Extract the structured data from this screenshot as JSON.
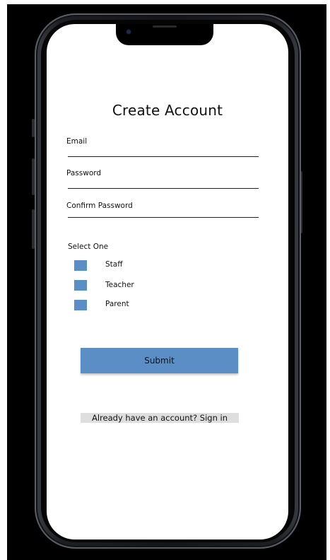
{
  "screen": {
    "title": "Create Account"
  },
  "form": {
    "fields": [
      {
        "label": "Email",
        "value": ""
      },
      {
        "label": "Password",
        "value": ""
      },
      {
        "label": "Confirm Password",
        "value": ""
      }
    ],
    "role_group": {
      "label": "Select One",
      "options": [
        {
          "label": "Staff",
          "checked": false
        },
        {
          "label": "Teacher",
          "checked": false
        },
        {
          "label": "Parent",
          "checked": false
        }
      ]
    },
    "submit_label": "Submit"
  },
  "footer": {
    "signin_link": "Already have an account? Sign in"
  },
  "colors": {
    "accent": "#5b8ec4",
    "link_background": "#dedede",
    "phone_frame": "#1c1e22",
    "backdrop": "#000000"
  }
}
